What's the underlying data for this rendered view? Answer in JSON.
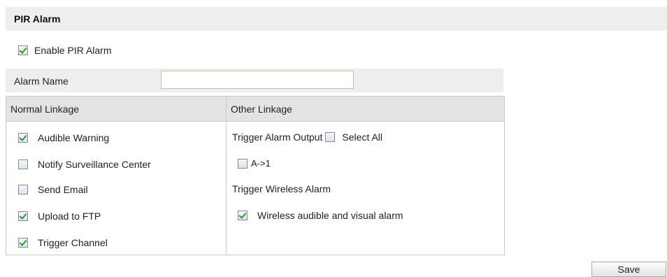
{
  "section_title": "PIR Alarm",
  "enable_pir": {
    "label": "Enable PIR Alarm",
    "checked": true
  },
  "alarm_name": {
    "label": "Alarm Name",
    "value": ""
  },
  "normal_linkage": {
    "header": "Normal Linkage",
    "items": [
      {
        "label": "Audible Warning",
        "checked": true
      },
      {
        "label": "Notify Surveillance Center",
        "checked": false
      },
      {
        "label": "Send Email",
        "checked": false
      },
      {
        "label": "Upload to FTP",
        "checked": true
      },
      {
        "label": "Trigger Channel",
        "checked": true
      }
    ]
  },
  "other_linkage": {
    "header": "Other Linkage",
    "trigger_alarm_output_label": "Trigger Alarm Output",
    "select_all": {
      "label": "Select All",
      "checked": false
    },
    "output_a1": {
      "label": "A->1",
      "checked": false
    },
    "trigger_wireless_label": "Trigger Wireless Alarm",
    "wireless_alarm": {
      "label": "Wireless audible and visual alarm",
      "checked": true
    }
  },
  "save_label": "Save",
  "colors": {
    "check_green": "#2f9a2f",
    "header_gray": "#e3e3e3",
    "bar_gray": "#eeeeee"
  }
}
